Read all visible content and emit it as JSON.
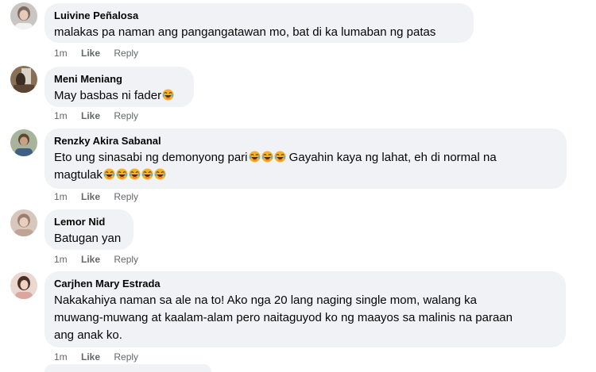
{
  "comments": [
    {
      "author": "Luivine Peñalosa",
      "text": "malakas pa naman ang pangangatawan mo, bat di ka lumaban ng patas",
      "time": "1m",
      "like": "Like",
      "reply": "Reply"
    },
    {
      "author": "Meni Meniang",
      "text": "May basbas ni fader",
      "time": "1m",
      "like": "Like",
      "reply": "Reply"
    },
    {
      "author": "Renzky Akira Sabanal",
      "text_line1": "Eto ung sinasabi ng demonyong pari",
      "text_line1b": " Gayahin kaya ng lahat, eh di normal na",
      "text_line2": "magtulak",
      "time": "1m",
      "like": "Like",
      "reply": "Reply"
    },
    {
      "author": "Lemor Nid",
      "text": "Batugan yan",
      "time": "1m",
      "like": "Like",
      "reply": "Reply"
    },
    {
      "author": "Carjhen Mary Estrada",
      "text_line1": "Nakakahiya naman sa ale na to! Ako nga 20 lang naging single mom, walang ka",
      "text_line2": "muwang-muwang at kaalam-alam pero naitaguyod ko ng maayos sa malinis na paraan",
      "text_line3": "ang anak ko.",
      "time": "1m",
      "like": "Like",
      "reply": "Reply"
    }
  ],
  "icons": {
    "emoji": "laughing-emoji-icon"
  }
}
